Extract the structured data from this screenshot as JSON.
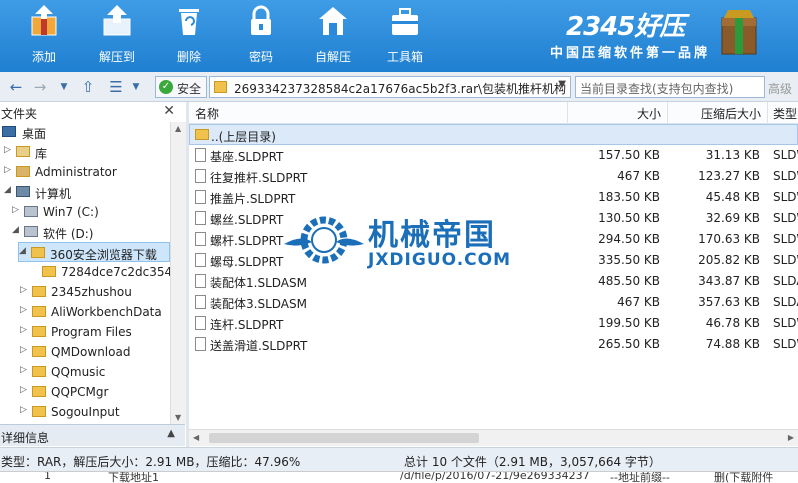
{
  "toolbar": {
    "buttons": [
      {
        "label": "添加"
      },
      {
        "label": "解压到"
      },
      {
        "label": "删除"
      },
      {
        "label": "密码"
      },
      {
        "label": "自解压"
      },
      {
        "label": "工具箱"
      }
    ],
    "brand_logo": "2345好压",
    "brand_slogan": "中国压缩软件第一品牌"
  },
  "addressbar": {
    "safe_label": "安全",
    "path": "269334237328584c2a17676ac5b2f3.rar\\包装机推杆机构",
    "search_placeholder": "当前目录查找(支持包内查找)",
    "advanced": "高级"
  },
  "sidebar": {
    "header": "文件夹",
    "items": [
      {
        "label": "桌面"
      },
      {
        "label": "库"
      },
      {
        "label": "Administrator"
      },
      {
        "label": "计算机"
      },
      {
        "label": "Win7 (C:)"
      },
      {
        "label": "软件 (D:)"
      },
      {
        "label": "360安全浏览器下载"
      },
      {
        "label": "7284dce7c2dc354"
      },
      {
        "label": "2345zhushou"
      },
      {
        "label": "AliWorkbenchData"
      },
      {
        "label": "Program Files"
      },
      {
        "label": "QMDownload"
      },
      {
        "label": "QQmusic"
      },
      {
        "label": "QQPCMgr"
      },
      {
        "label": "SogouInput"
      }
    ],
    "details_header": "详细信息"
  },
  "filelist": {
    "columns": {
      "name": "名称",
      "size": "大小",
      "compressed": "压缩后大小",
      "type": "类型"
    },
    "parent": "..(上层目录)",
    "rows": [
      {
        "name": "基座.SLDPRT",
        "size": "157.50 KB",
        "compressed": "31.13 KB",
        "type": "SLDW"
      },
      {
        "name": "往复推杆.SLDPRT",
        "size": "467 KB",
        "compressed": "123.27 KB",
        "type": "SLDW"
      },
      {
        "name": "推盖片.SLDPRT",
        "size": "183.50 KB",
        "compressed": "45.48 KB",
        "type": "SLDW"
      },
      {
        "name": "螺丝.SLDPRT",
        "size": "130.50 KB",
        "compressed": "32.69 KB",
        "type": "SLDW"
      },
      {
        "name": "螺杆.SLDPRT",
        "size": "294.50 KB",
        "compressed": "170.63 KB",
        "type": "SLDW"
      },
      {
        "name": "螺母.SLDPRT",
        "size": "335.50 KB",
        "compressed": "205.82 KB",
        "type": "SLDW"
      },
      {
        "name": "装配体1.SLDASM",
        "size": "485.50 KB",
        "compressed": "343.87 KB",
        "type": "SLDA"
      },
      {
        "name": "装配体3.SLDASM",
        "size": "467 KB",
        "compressed": "357.63 KB",
        "type": "SLDA"
      },
      {
        "name": "连杆.SLDPRT",
        "size": "199.50 KB",
        "compressed": "46.78 KB",
        "type": "SLDW"
      },
      {
        "name": "送盖滑道.SLDPRT",
        "size": "265.50 KB",
        "compressed": "74.88 KB",
        "type": "SLDW"
      }
    ]
  },
  "watermark": {
    "title": "机械帝国",
    "url": "JXDIGUO.COM"
  },
  "statusbar": {
    "left": "类型：RAR，解压后大小：2.91 MB，压缩比：47.96%",
    "right": "总计 10 个文件（2.91 MB，3,057,664 字节）"
  },
  "bottom": {
    "c1": "1",
    "c2": "下载地址1",
    "c3": "/d/file/p/2016/07-21/9e269334237",
    "c4": "--地址前缀--",
    "c5": "删(下载附件"
  },
  "colors": {
    "toolbar": "#2a8ad9",
    "accent": "#1b6fb8",
    "folder": "#f0c14b"
  }
}
